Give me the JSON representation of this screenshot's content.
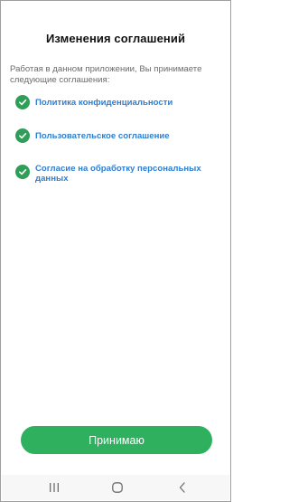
{
  "screen": {
    "title": "Изменения соглашений",
    "intro": "Работая в данном приложении, Вы принимаете следующие соглашения:"
  },
  "agreements": [
    {
      "label": "Политика конфиденциальности",
      "icon": "check-circle-icon"
    },
    {
      "label": "Пользовательское соглашение",
      "icon": "check-circle-icon"
    },
    {
      "label": "Согласие на обработку персональных данных",
      "icon": "check-circle-icon"
    }
  ],
  "actions": {
    "accept_label": "Принимаю"
  },
  "navbar": {
    "buttons": [
      "recents-icon",
      "home-icon",
      "back-icon"
    ]
  },
  "colors": {
    "accent_green": "#2fb05f",
    "check_green": "#2e9e58",
    "link_blue": "#2f7fd1",
    "text_dark": "#111111",
    "text_muted": "#6b6b6b"
  }
}
